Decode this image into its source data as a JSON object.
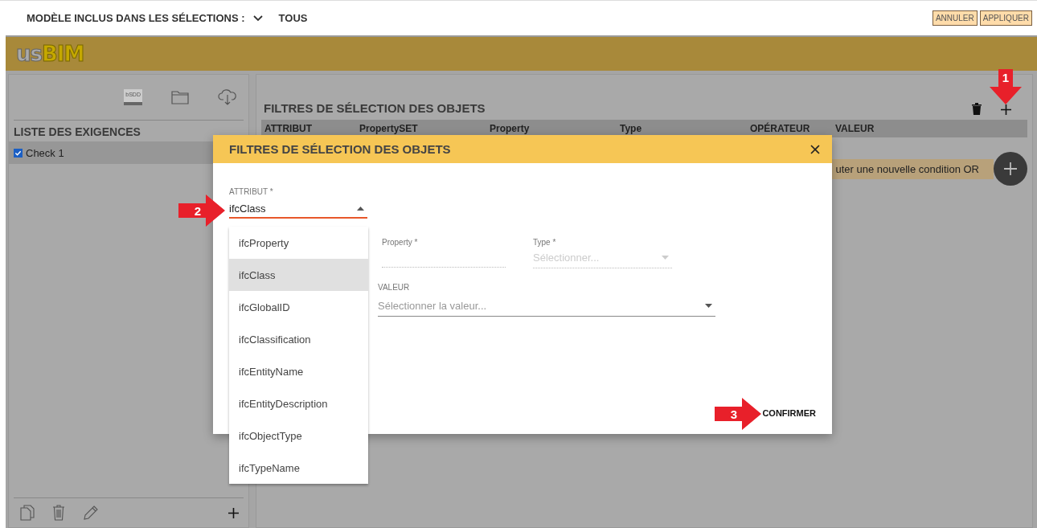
{
  "top_bar": {
    "model_label": "MODÈLE INCLUS DANS LES SÉLECTIONS :",
    "model_value": "TOUS",
    "buttons": [
      "ANNULER",
      "APPLIQUER"
    ]
  },
  "logo": {
    "prefix": "us",
    "suffix": "BIM"
  },
  "left_panel": {
    "bsdd_label": "bSDD",
    "heading": "LISTE DES EXIGENCES",
    "requirements": [
      {
        "label": "Check 1",
        "checked": true,
        "selected": true
      }
    ]
  },
  "filters_panel": {
    "title": "FILTRES DE SÉLECTION DES OBJETS",
    "columns": [
      "ATTRIBUT",
      "PropertySET",
      "Property",
      "Type",
      "OPÉRATEUR",
      "VALEUR"
    ],
    "add_or_button": "uter une nouvelle condition OR"
  },
  "dialog": {
    "title": "FILTRES DE SÉLECTION DES OBJETS",
    "attribute": {
      "label": "ATTRIBUT *",
      "value": "ifcClass",
      "expanded": true
    },
    "options": [
      {
        "label": "ifcProperty",
        "selected": false
      },
      {
        "label": "ifcClass",
        "selected": true
      },
      {
        "label": "ifcGlobalID",
        "selected": false
      },
      {
        "label": "ifcClassification",
        "selected": false
      },
      {
        "label": "ifcEntityName",
        "selected": false
      },
      {
        "label": "ifcEntityDescription",
        "selected": false
      },
      {
        "label": "ifcObjectType",
        "selected": false
      },
      {
        "label": "ifcTypeName",
        "selected": false
      }
    ],
    "property": {
      "label": "Property *"
    },
    "type": {
      "label": "Type *",
      "placeholder": "Sélectionner..."
    },
    "value": {
      "label": "VALEUR",
      "placeholder": "Sélectionner la valeur..."
    },
    "confirm": "CONFIRMER"
  },
  "annotations": [
    {
      "number": "1",
      "kind": "down"
    },
    {
      "number": "2",
      "kind": "right"
    },
    {
      "number": "3",
      "kind": "right"
    }
  ]
}
